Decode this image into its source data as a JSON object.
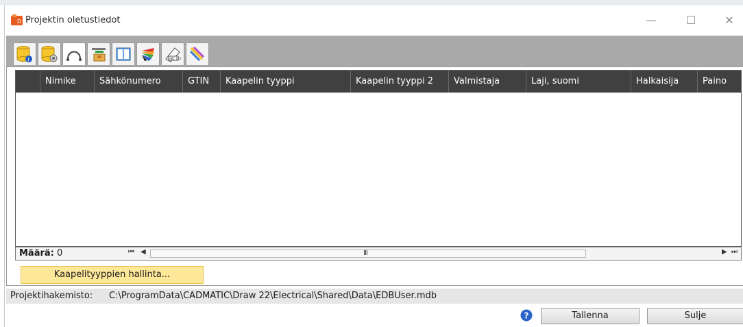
{
  "window": {
    "title": "Projektin oletustiedot",
    "minimize_glyph": "—",
    "maximize_glyph": "☐",
    "close_glyph": "✕"
  },
  "tabs": [
    {
      "icon": "database-info-icon"
    },
    {
      "icon": "database-settings-icon"
    },
    {
      "icon": "cable-icon",
      "active": true
    },
    {
      "icon": "component-box-icon"
    },
    {
      "icon": "book-icon"
    },
    {
      "icon": "color-fan-icon"
    },
    {
      "icon": "label-tag-icon"
    },
    {
      "icon": "color-pens-icon"
    }
  ],
  "grid": {
    "columns": [
      "",
      "Nimike",
      "Sähkönumero",
      "GTIN",
      "Kaapelin tyyppi",
      "Kaapelin tyyppi 2",
      "Valmistaja",
      "Laji, suomi",
      "Halkaisija",
      "Paino"
    ],
    "rows": []
  },
  "status": {
    "count_label": "Määrä:",
    "count_value": "0",
    "scroll_left_first": "⏮",
    "scroll_left": "◀",
    "scroll_right": "▶",
    "scroll_right_last": "⏭",
    "thumb": "Ⅲ"
  },
  "manage_button": "Kaapelityyppien hallinta...",
  "path": {
    "label": "Projektihakemisto:",
    "value": "C:\\ProgramData\\CADMATIC\\Draw 22\\Electrical\\Shared\\Data\\EDBUser.mdb"
  },
  "buttons": {
    "save": "Tallenna",
    "close": "Sulje"
  },
  "colors": {
    "accent_button": "#fde89a",
    "grid_header": "#404040",
    "tabbar": "#a9a9a9"
  }
}
